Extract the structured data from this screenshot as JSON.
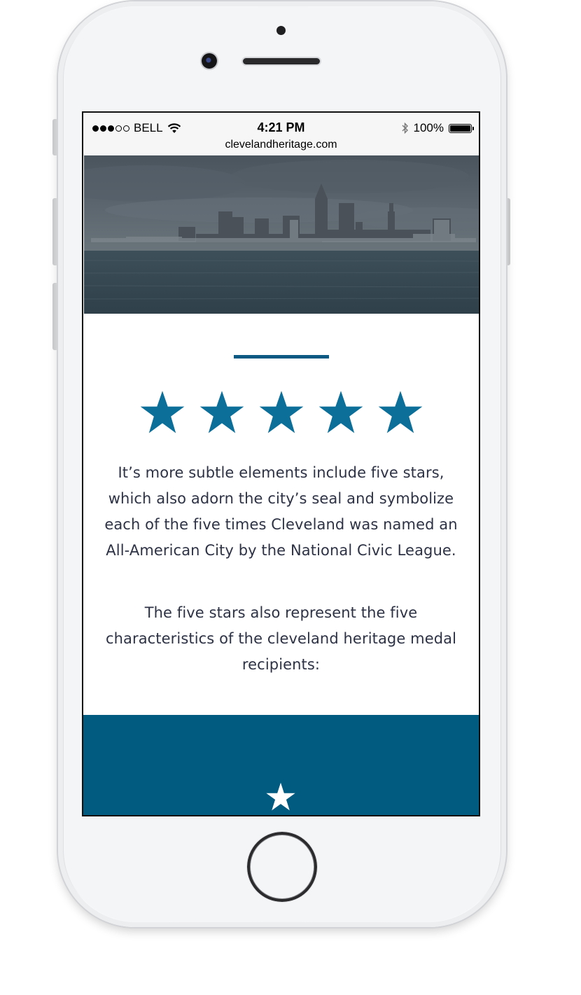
{
  "status_bar": {
    "carrier": "BELL",
    "time": "4:21 PM",
    "url": "clevelandheritage.com",
    "battery_percent": "100%",
    "battery_level": 1.0,
    "signal_bars_filled": 3,
    "signal_bars_total": 5
  },
  "content": {
    "star_count": 5,
    "paragraph_1": "It’s more subtle elements include five stars, which also adorn the city’s seal and symbolize each of the five times Cleveland was named an All-American City by the National Civic League.",
    "paragraph_2": "The five stars also represent the five characteristics of the cleveland heritage medal recipients:"
  },
  "colors": {
    "accent_blue": "#0a5a84",
    "star_blue": "#0b6f9a",
    "band_blue": "#015a80",
    "text": "#2d3245",
    "hero_overlay": "#3b4650"
  },
  "icons": {
    "wifi": "wifi-icon",
    "bluetooth": "bluetooth-icon",
    "battery": "battery-icon",
    "star": "star-icon"
  }
}
